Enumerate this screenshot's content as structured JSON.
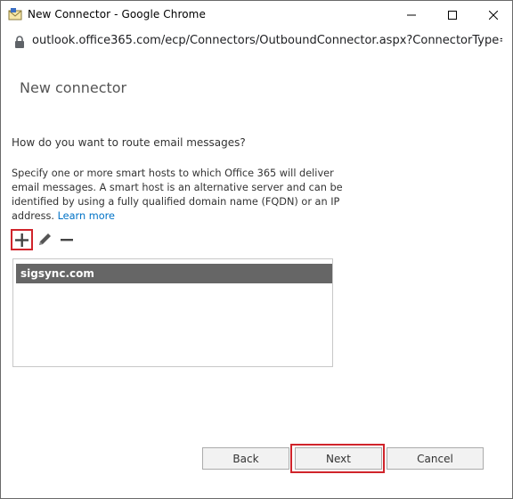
{
  "window": {
    "title": "New Connector - Google Chrome",
    "url": "outlook.office365.com/ecp/Connectors/OutboundConnector.aspx?ConnectorType=..."
  },
  "page": {
    "title": "New connector",
    "question": "How do you want to route email messages?",
    "description": "Specify one or more smart hosts to which Office 365 will deliver email messages. A smart host is an alternative server and can be identified by using a fully qualified domain name (FQDN) or an IP address.",
    "learn_more": "Learn more"
  },
  "toolbar": {
    "icons": [
      "plus-icon",
      "pencil-icon",
      "minus-icon"
    ]
  },
  "smart_hosts": [
    "sigsync.com"
  ],
  "buttons": {
    "back": "Back",
    "next": "Next",
    "cancel": "Cancel"
  },
  "colors": {
    "selected_row": "#666666",
    "highlight": "#d0242b",
    "link": "#0072c6"
  }
}
